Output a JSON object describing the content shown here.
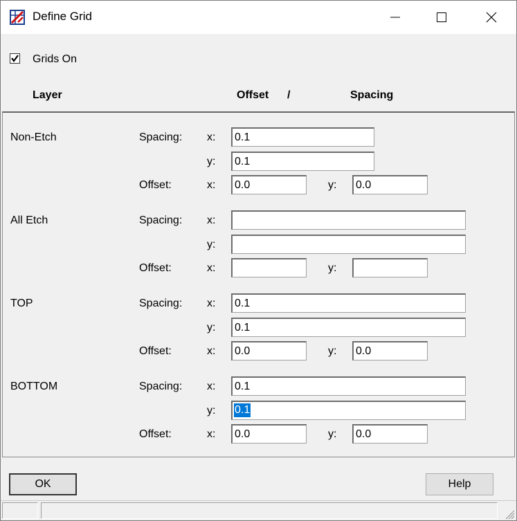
{
  "window": {
    "title": "Define Grid"
  },
  "grids_on": {
    "label": "Grids On",
    "checked": true
  },
  "headers": {
    "layer": "Layer",
    "offset": "Offset",
    "separator": "/",
    "spacing": "Spacing"
  },
  "labels": {
    "spacing": "Spacing:",
    "offset": "Offset:",
    "x": "x:",
    "y": "y:"
  },
  "layers": [
    {
      "name": "Non-Etch",
      "spacing_x": "0.1",
      "spacing_y": "0.1",
      "offset_x": "0.0",
      "offset_y": "0.0"
    },
    {
      "name": "All Etch",
      "spacing_x": "",
      "spacing_y": "",
      "offset_x": "",
      "offset_y": ""
    },
    {
      "name": "TOP",
      "spacing_x": "0.1",
      "spacing_y": "0.1",
      "offset_x": "0.0",
      "offset_y": "0.0"
    },
    {
      "name": "BOTTOM",
      "spacing_x": "0.1",
      "spacing_y": "0.1",
      "offset_x": "0.0",
      "offset_y": "0.0"
    }
  ],
  "buttons": {
    "ok": "OK",
    "help": "Help"
  },
  "colors": {
    "selection": "#0078d7"
  }
}
